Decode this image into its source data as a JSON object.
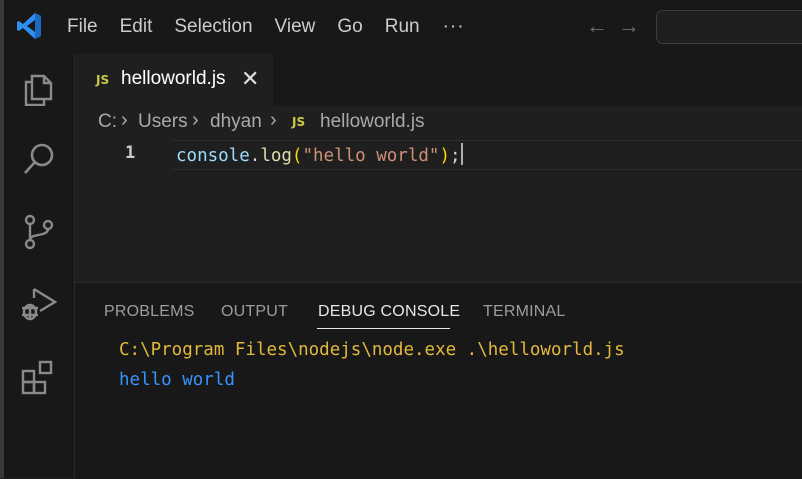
{
  "menu": {
    "items": [
      "File",
      "Edit",
      "Selection",
      "View",
      "Go",
      "Run"
    ],
    "more": "···"
  },
  "nav": {
    "back": "←",
    "forward": "→"
  },
  "activity_bar": {
    "icons": [
      "explorer-icon",
      "search-icon",
      "source-control-icon",
      "run-debug-icon",
      "extensions-icon"
    ]
  },
  "editor": {
    "tab": {
      "badge": "JS",
      "filename": "helloworld.js",
      "close": "✕"
    },
    "breadcrumb": {
      "segments": [
        "C:",
        "Users",
        "dhyan"
      ],
      "file_badge": "JS",
      "file": "helloworld.js",
      "separator": "›"
    },
    "line_number": "1",
    "code": {
      "object": "console",
      "dot": ".",
      "method": "log",
      "open_paren": "(",
      "string": "\"hello world\"",
      "close_paren": ")",
      "semicolon": ";"
    }
  },
  "panel": {
    "tabs": [
      "PROBLEMS",
      "OUTPUT",
      "DEBUG CONSOLE",
      "TERMINAL"
    ],
    "active_tab": "DEBUG CONSOLE",
    "output_lines": [
      "C:\\Program Files\\nodejs\\node.exe .\\helloworld.js",
      "hello world"
    ]
  },
  "colors": {
    "accent_logo": "#2f8ff0",
    "js_badge": "#cbcb41",
    "output_path": "#e2b93d",
    "output_text": "#3794ff"
  }
}
